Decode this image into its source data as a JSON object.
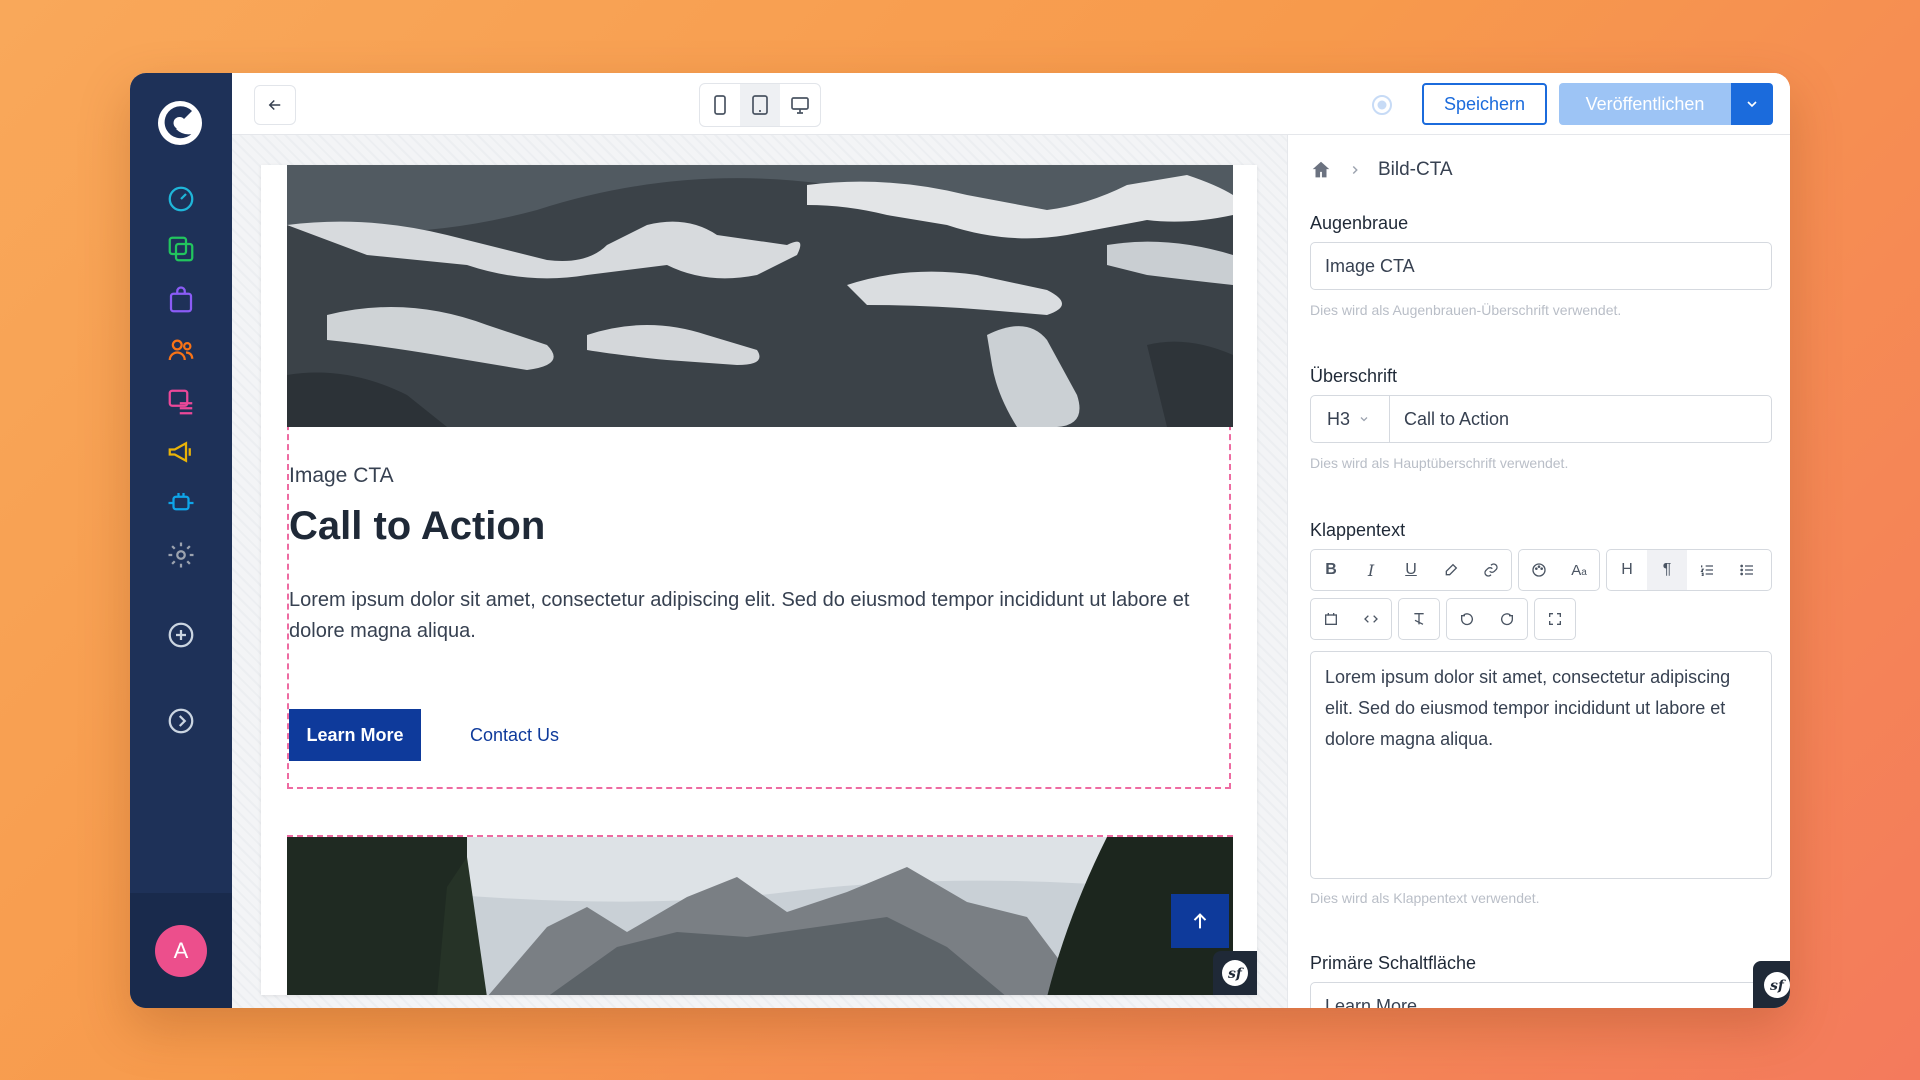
{
  "toolbar": {
    "save_label": "Speichern",
    "publish_label": "Veröffentlichen"
  },
  "sidebar": {
    "items": [
      {
        "icon": "dashboard-gauge-icon",
        "color": "#1fb6d9"
      },
      {
        "icon": "pages-copy-icon",
        "color": "#22c55e"
      },
      {
        "icon": "shopping-bag-icon",
        "color": "#8b5cf6"
      },
      {
        "icon": "users-icon",
        "color": "#f97316"
      },
      {
        "icon": "content-list-icon",
        "color": "#ec4899"
      },
      {
        "icon": "megaphone-icon",
        "color": "#eab308"
      },
      {
        "icon": "plugin-icon",
        "color": "#0ea5e9"
      },
      {
        "icon": "settings-gear-icon",
        "color": "#9ca3af"
      }
    ],
    "avatar_initial": "A"
  },
  "preview": {
    "eyebrow": "Image CTA",
    "title": "Call to Action",
    "text": "Lorem ipsum dolor sit amet, consectetur adipiscing elit. Sed do eiusmod tempor incididunt ut labore et dolore magna aliqua.",
    "primary_button": "Learn More",
    "secondary_link": "Contact Us"
  },
  "panel": {
    "breadcrumb_current": "Bild-CTA",
    "eyebrow_label": "Augenbraue",
    "eyebrow_value": "Image CTA",
    "eyebrow_help": "Dies wird als Augenbrauen-Überschrift verwendet.",
    "heading_label": "Überschrift",
    "heading_level": "H3",
    "heading_value": "Call to Action",
    "heading_help": "Dies wird als Hauptüberschrift verwendet.",
    "blurb_label": "Klappentext",
    "blurb_value": "Lorem ipsum dolor sit amet, consectetur adipiscing elit. Sed do eiusmod tempor incididunt ut labore et dolore magna aliqua.",
    "blurb_help": "Dies wird als Klappentext verwendet.",
    "primary_label": "Primäre Schaltfläche",
    "primary_value": "Learn More"
  },
  "colors": {
    "sidebar": "#1e3158",
    "accent": "#1b6bdc",
    "brand_button": "#0e3a9b",
    "selection": "#ee6ba2"
  }
}
